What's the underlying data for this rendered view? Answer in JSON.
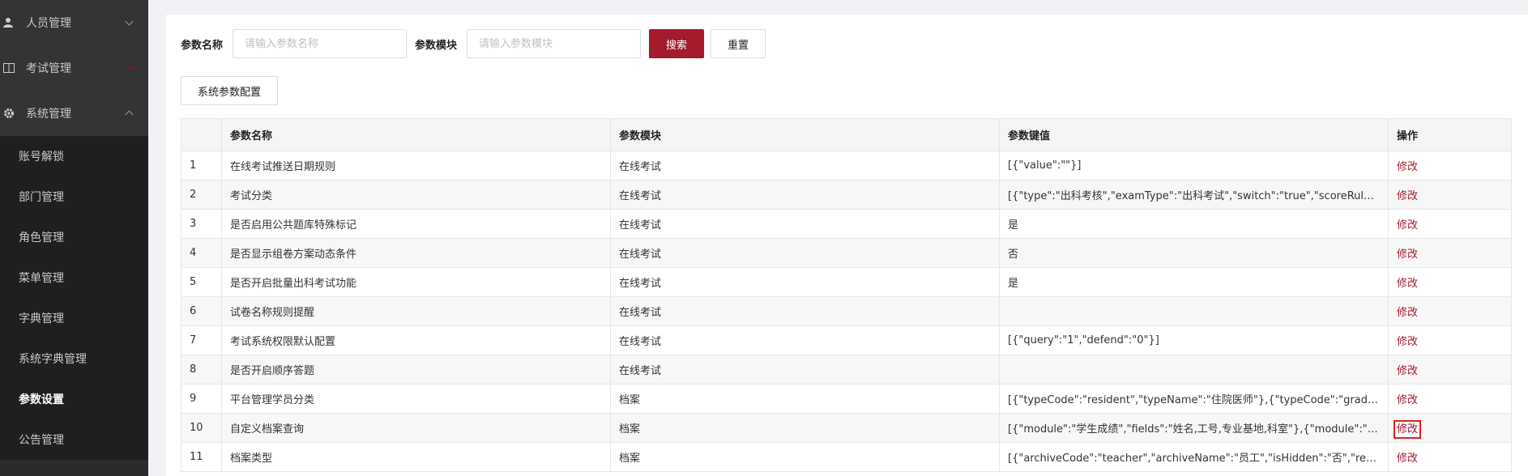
{
  "sidebar": {
    "groups": [
      {
        "label": "人员管理",
        "icon": "person-icon"
      },
      {
        "label": "考试管理",
        "icon": "book-icon"
      },
      {
        "label": "系统管理",
        "icon": "gear-icon"
      }
    ],
    "items": [
      {
        "label": "账号解锁"
      },
      {
        "label": "部门管理"
      },
      {
        "label": "角色管理"
      },
      {
        "label": "菜单管理"
      },
      {
        "label": "字典管理"
      },
      {
        "label": "系统字典管理"
      },
      {
        "label": "参数设置"
      },
      {
        "label": "公告管理"
      }
    ]
  },
  "search": {
    "name_label": "参数名称",
    "name_placeholder": "请输入参数名称",
    "module_label": "参数模块",
    "module_placeholder": "请输入参数模块",
    "search_button": "搜索",
    "reset_button": "重置"
  },
  "toolbar": {
    "config_button": "系统参数配置"
  },
  "table": {
    "headers": [
      "参数名称",
      "参数模块",
      "参数键值",
      "操作"
    ],
    "rows": [
      {
        "index": "1",
        "name": "在线考试推送日期规则",
        "module": "在线考试",
        "value": "[{\"value\":\"\"}]",
        "action": "修改"
      },
      {
        "index": "2",
        "name": "考试分类",
        "module": "在线考试",
        "value": "[{\"type\":\"出科考核\",\"examType\":\"出科考试\",\"switch\":\"true\",\"scoreRules\":...",
        "action": "修改"
      },
      {
        "index": "3",
        "name": "是否启用公共题库特殊标记",
        "module": "在线考试",
        "value": "是",
        "action": "修改"
      },
      {
        "index": "4",
        "name": "是否显示组卷方案动态条件",
        "module": "在线考试",
        "value": "否",
        "action": "修改"
      },
      {
        "index": "5",
        "name": "是否开启批量出科考试功能",
        "module": "在线考试",
        "value": "是",
        "action": "修改"
      },
      {
        "index": "6",
        "name": "试卷名称规则提醒",
        "module": "在线考试",
        "value": "",
        "action": "修改"
      },
      {
        "index": "7",
        "name": "考试系统权限默认配置",
        "module": "在线考试",
        "value": "[{\"query\":\"1\",\"defend\":\"0\"}]",
        "action": "修改"
      },
      {
        "index": "8",
        "name": "是否开启顺序答题",
        "module": "在线考试",
        "value": "",
        "action": "修改"
      },
      {
        "index": "9",
        "name": "平台管理学员分类",
        "module": "档案",
        "value": "[{\"typeCode\":\"resident\",\"typeName\":\"住院医师\"},{\"typeCode\":\"graduate...",
        "action": "修改"
      },
      {
        "index": "10",
        "name": "自定义档案查询",
        "module": "档案",
        "value": "[{\"module\":\"学生成绩\",\"fields\":\"姓名,工号,专业基地,科室\"},{\"module\":\"统...",
        "action": "修改"
      },
      {
        "index": "11",
        "name": "档案类型",
        "module": "档案",
        "value": "[{\"archiveCode\":\"teacher\",\"archiveName\":\"员工\",\"isHidden\":\"否\",\"registe...",
        "action": "修改"
      }
    ]
  }
}
